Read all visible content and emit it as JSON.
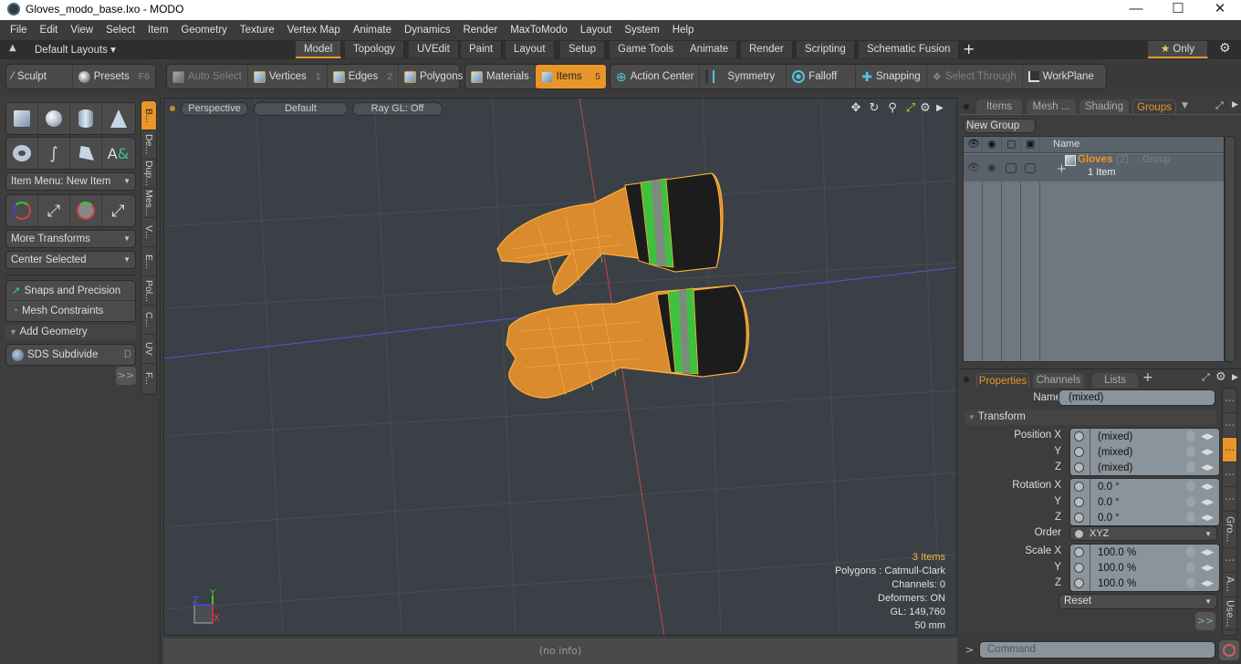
{
  "window": {
    "title": "Gloves_modo_base.lxo - MODO",
    "minimize": "—",
    "maximize": "☐",
    "close": "✕"
  },
  "menu": [
    "File",
    "Edit",
    "View",
    "Select",
    "Item",
    "Geometry",
    "Texture",
    "Vertex Map",
    "Animate",
    "Dynamics",
    "Render",
    "MaxToModo",
    "Layout",
    "System",
    "Help"
  ],
  "layouts": {
    "selector": "Default Layouts ▾",
    "tabs": [
      "Model",
      "Topology",
      "UVEdit",
      "Paint",
      "Layout",
      "Setup",
      "Game Tools",
      "Animate",
      "Render",
      "Scripting",
      "Schematic Fusion"
    ],
    "active": "Model",
    "add": "+",
    "only": "Only",
    "star": "★"
  },
  "toolbar": {
    "sculpt": "Sculpt",
    "presets": "Presets",
    "presets_hotkey": "F6",
    "auto_select": "Auto Select",
    "vertices": "Vertices",
    "vertices_hotkey": "1",
    "edges": "Edges",
    "edges_hotkey": "2",
    "polygons": "Polygons",
    "materials": "Materials",
    "items": "Items",
    "items_hotkey": "5",
    "action_center": "Action Center",
    "symmetry": "Symmetry",
    "falloff": "Falloff",
    "snapping": "Snapping",
    "select_through": "Select Through",
    "workplane": "WorkPlane"
  },
  "left_panel": {
    "item_menu": "Item Menu: New Item",
    "more_transforms": "More Transforms",
    "center_selected": "Center Selected",
    "snaps": "Snaps and Precision",
    "mesh_constraints": "Mesh Constraints",
    "add_geometry": "Add Geometry",
    "sds_subdivide": "SDS Subdivide",
    "sds_hotkey": "D",
    "more": ">>",
    "vtabs": [
      "B...",
      "De...",
      "Dup...",
      "Mes...",
      "V...",
      "E...",
      "Pol...",
      "C...",
      "UV",
      "F..."
    ]
  },
  "viewport": {
    "view": "Perspective",
    "shading": "Default",
    "raygl": "Ray GL: Off",
    "stats": {
      "items": "3 Items",
      "polygons": "Polygons : Catmull-Clark",
      "channels": "Channels: 0",
      "deformers": "Deformers: ON",
      "gl": "GL: 149,760",
      "scale": "50 mm"
    },
    "axis": {
      "x": "X",
      "y": "Y",
      "z": "Z"
    }
  },
  "status": "(no info)",
  "groups_panel": {
    "tabs": [
      "Items",
      "Mesh ...",
      "Shading",
      "Groups"
    ],
    "active": "Groups",
    "new_group": "New Group",
    "col_name": "Name",
    "row": {
      "name": "Gloves",
      "count": "(2)",
      "type": ": Group",
      "sub": "1 Item"
    }
  },
  "properties_panel": {
    "tabs": [
      "Properties",
      "Channels",
      "Lists"
    ],
    "active": "Properties",
    "add": "+",
    "name_label": "Name",
    "name_value": "(mixed)",
    "section": "Transform",
    "position": {
      "label": "Position X",
      "x": "(mixed)",
      "y": "(mixed)",
      "z": "(mixed)"
    },
    "rotation": {
      "label": "Rotation X",
      "x": "0.0 °",
      "y": "0.0 °",
      "z": "0.0 °"
    },
    "order": {
      "label": "Order",
      "value": "XYZ"
    },
    "scale": {
      "label": "Scale X",
      "x": "100.0 %",
      "y": "100.0 %",
      "z": "100.0 %"
    },
    "axis_y": "Y",
    "axis_z": "Z",
    "reset": "Reset",
    "more": ">>",
    "vtabs": [
      "⋮",
      "⋮",
      "⋮",
      "⋮",
      "⋮",
      "Gro...",
      "⋮",
      "A...",
      "Use...",
      "⋮"
    ]
  },
  "command": {
    "prompt": ">",
    "placeholder": "Command"
  },
  "colors": {
    "accent": "#e8962a",
    "viewport_bg": "#3b4046"
  }
}
